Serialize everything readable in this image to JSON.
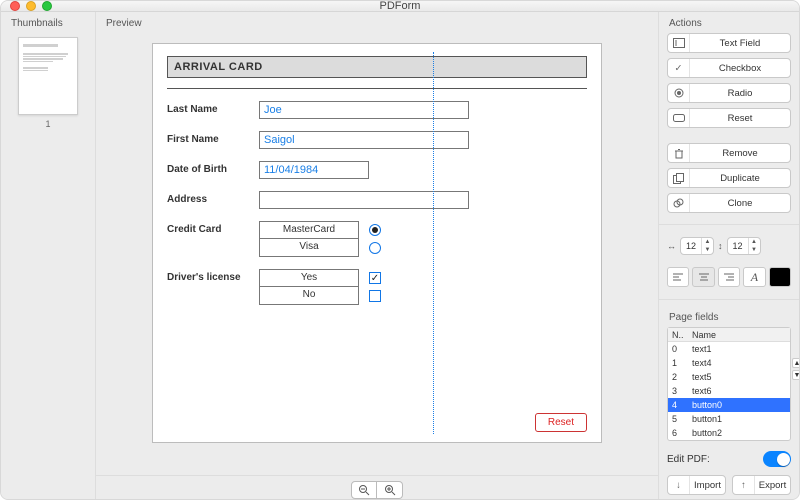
{
  "window": {
    "title": "PDForm"
  },
  "panels": {
    "thumbnails": "Thumbnails",
    "preview": "Preview",
    "actions": "Actions",
    "page_fields": "Page fields",
    "edit_pdf": "Edit PDF:"
  },
  "thumbnail": {
    "page_number": "1"
  },
  "form": {
    "title": "ARRIVAL CARD",
    "last_name": {
      "label": "Last Name",
      "value": "Joe"
    },
    "first_name": {
      "label": "First Name",
      "value": "Saigol"
    },
    "dob": {
      "label": "Date of Birth",
      "value": "11/04/1984"
    },
    "address": {
      "label": "Address",
      "value": ""
    },
    "credit_card": {
      "label": "Credit Card",
      "options": [
        "MasterCard",
        "Visa"
      ],
      "selected_index": 0
    },
    "license": {
      "label": "Driver's license",
      "options": [
        "Yes",
        "No"
      ],
      "selected_index": 0
    },
    "reset": "Reset"
  },
  "actions": {
    "text_field": "Text Field",
    "checkbox": "Checkbox",
    "radio": "Radio",
    "reset": "Reset",
    "remove": "Remove",
    "duplicate": "Duplicate",
    "clone": "Clone",
    "import": "Import",
    "export": "Export"
  },
  "coords": {
    "x": "12",
    "y": "12"
  },
  "fields_table": {
    "headers": [
      "N..",
      "Name"
    ],
    "rows": [
      {
        "n": "0",
        "name": "text1"
      },
      {
        "n": "1",
        "name": "text4"
      },
      {
        "n": "2",
        "name": "text5"
      },
      {
        "n": "3",
        "name": "text6"
      },
      {
        "n": "4",
        "name": "button0"
      },
      {
        "n": "5",
        "name": "button1"
      },
      {
        "n": "6",
        "name": "button2"
      }
    ],
    "selected_index": 4
  },
  "edit_pdf_on": true
}
